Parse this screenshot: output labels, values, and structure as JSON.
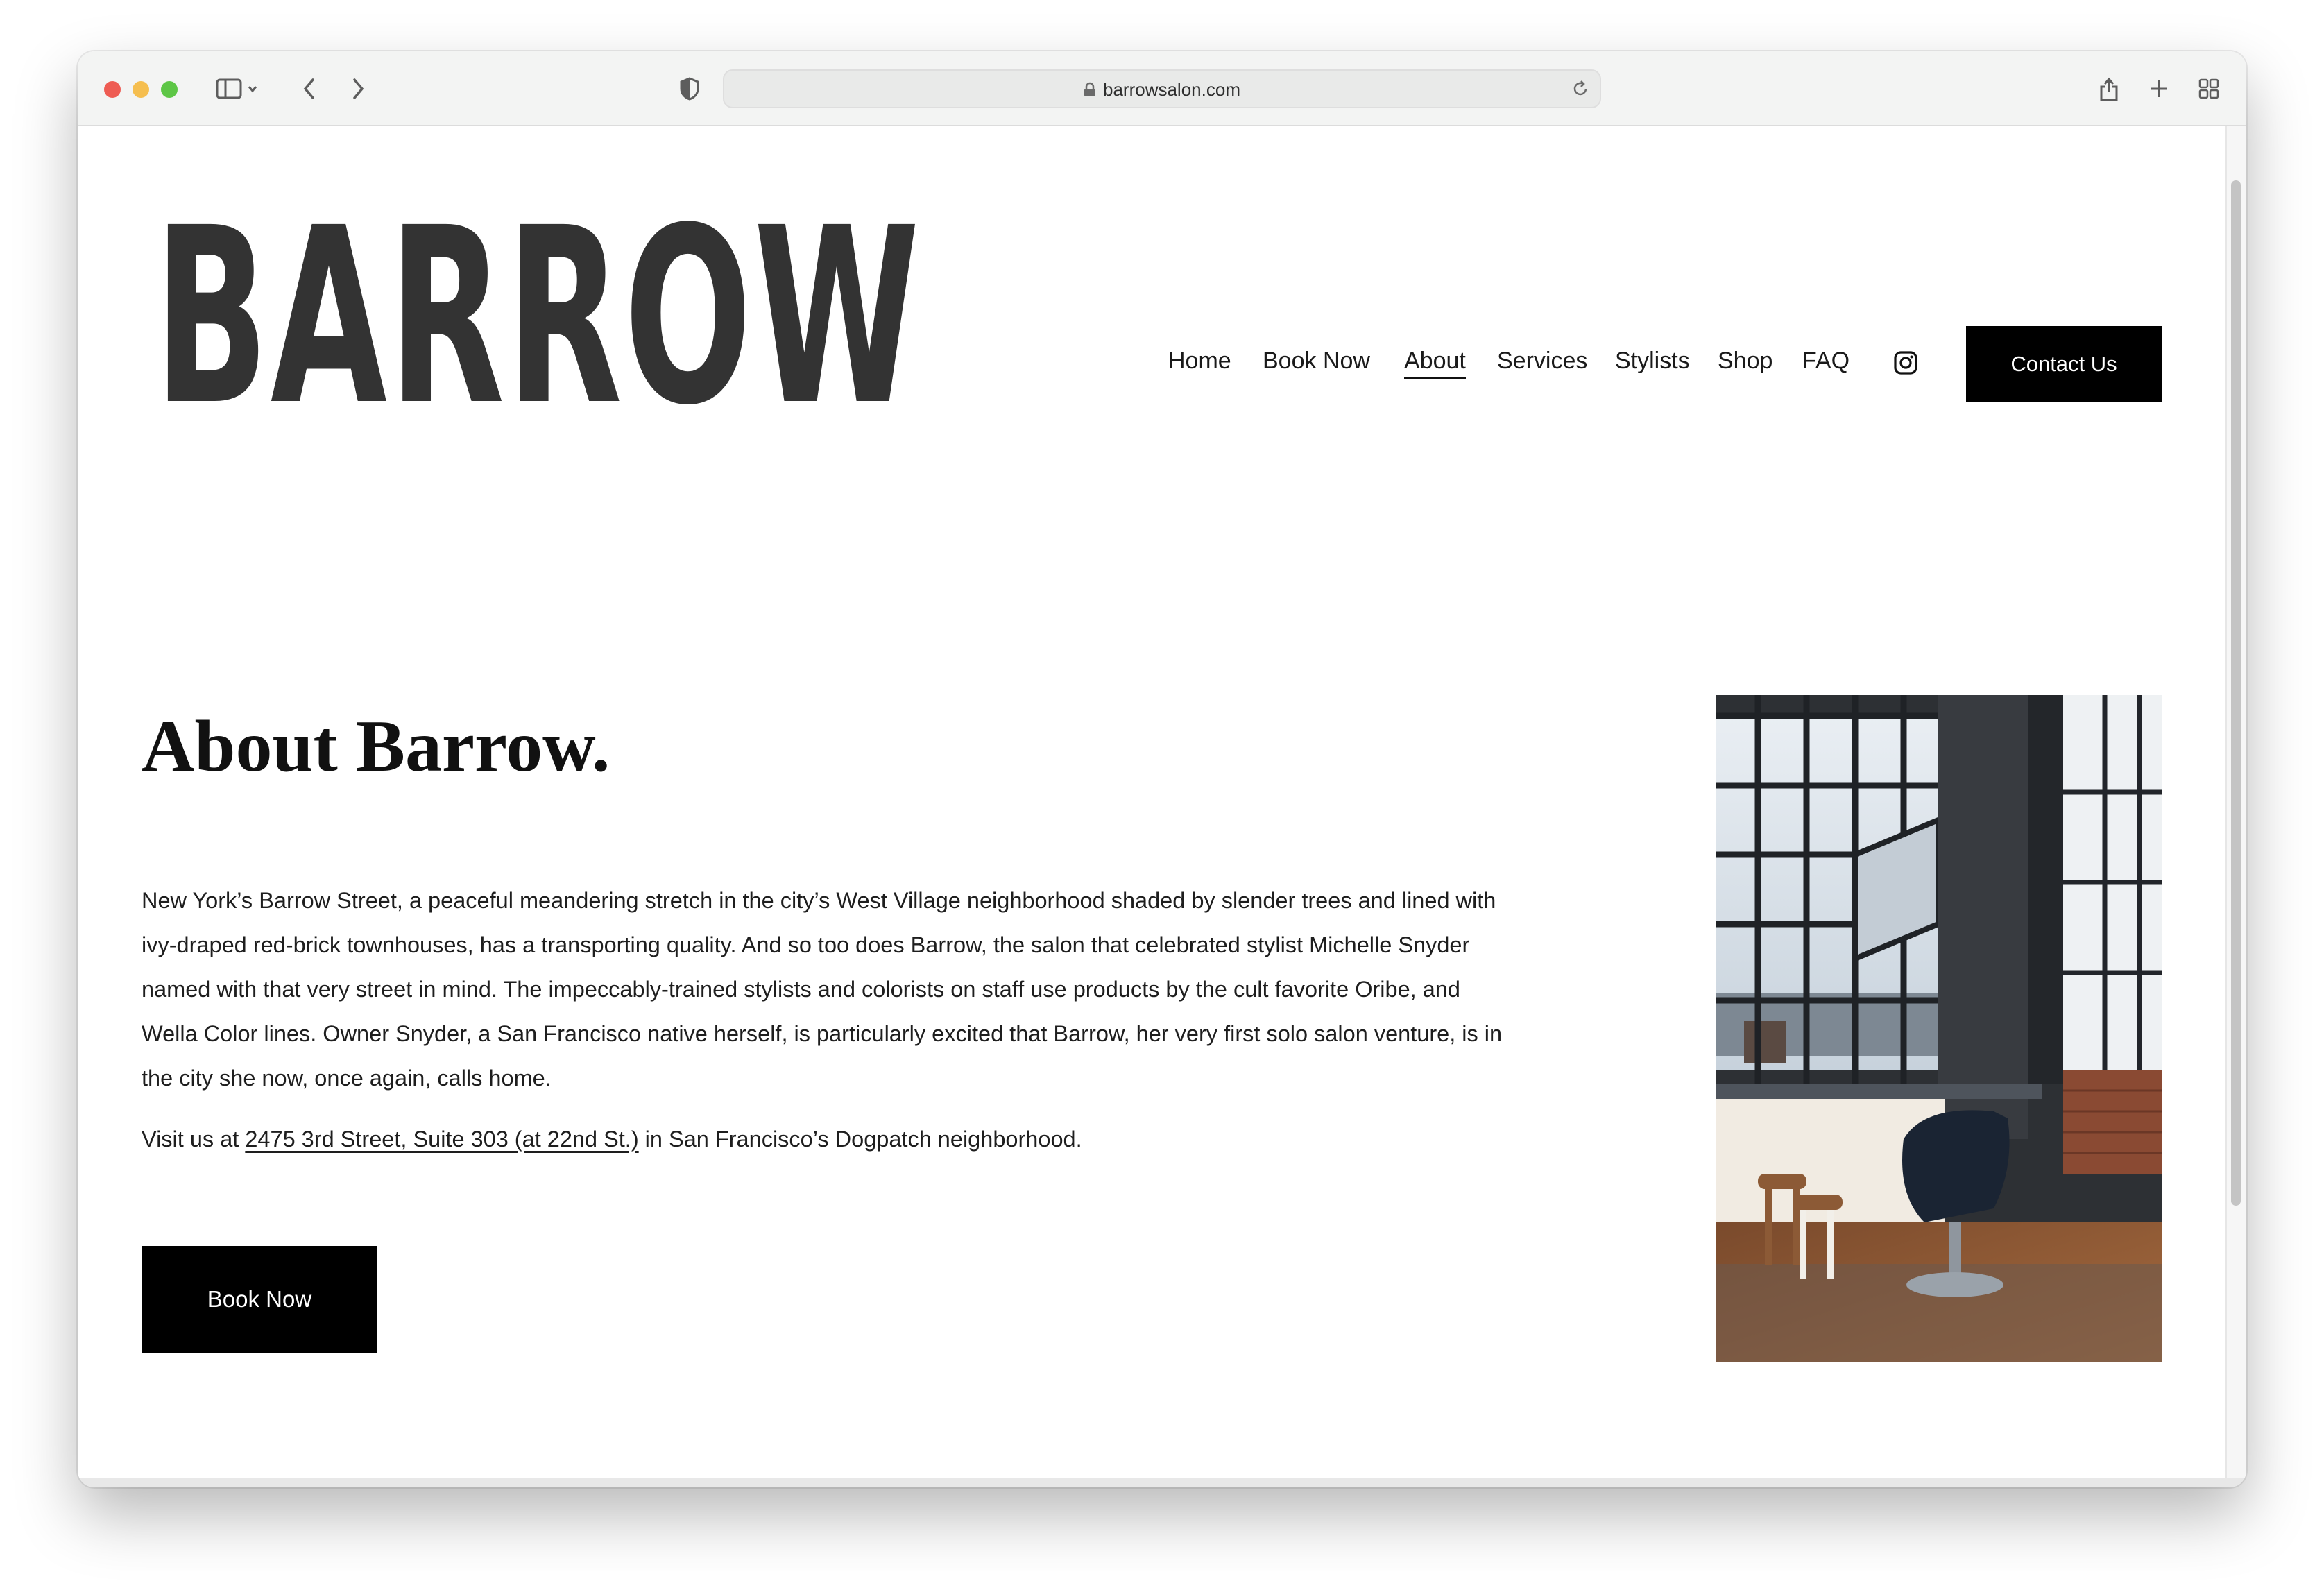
{
  "browser": {
    "url": "barrowsalon.com"
  },
  "site": {
    "logo": "BARROW",
    "nav": [
      {
        "label": "Home"
      },
      {
        "label": "Book Now"
      },
      {
        "label": "About"
      },
      {
        "label": "Services"
      },
      {
        "label": "Stylists"
      },
      {
        "label": "Shop"
      },
      {
        "label": "FAQ"
      }
    ],
    "active_nav": "About",
    "social_icon": "instagram-icon",
    "contact_label": "Contact Us"
  },
  "about": {
    "heading": "About Barrow.",
    "paragraph": "New York’s Barrow Street, a peaceful meandering stretch in the city’s West Village neighborhood shaded by slender trees and lined with ivy-draped red-brick townhouses, has a transporting quality. And so too does Barrow, the salon that celebrated stylist Michelle Snyder named with that very street in mind. The impeccably-trained stylists and colorists on staff use products by the cult favorite Oribe, and Wella Color lines. Owner Snyder, a San Francisco native herself, is particularly excited that Barrow, her very first solo salon venture, is in the city she now, once again, calls home.",
    "visit_prefix": "Visit us at ",
    "address_link": "2475 3rd Street, Suite 303 (at 22nd St.)",
    "visit_suffix": " in San Francisco’s Dogpatch neighborhood.",
    "book_label": "Book Now"
  },
  "colors": {
    "accent": "#000000",
    "logo": "#333333",
    "traffic_red": "#ee5c53",
    "traffic_yellow": "#f5be4f",
    "traffic_green": "#5dc646"
  }
}
